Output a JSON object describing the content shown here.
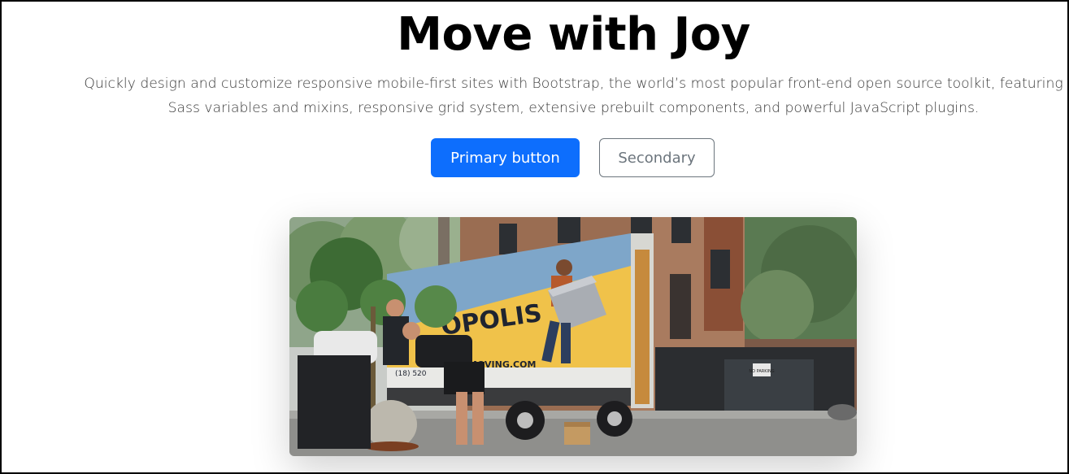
{
  "hero": {
    "title": "Move with Joy",
    "lead": "Quickly design and customize responsive mobile-first sites with Bootstrap, the world’s most popular front-end open source toolkit, featuring Sass variables and mixins, responsive grid system, extensive prebuilt components, and powerful JavaScript plugins.",
    "primary_button": "Primary button",
    "secondary_button": "Secondary"
  },
  "image": {
    "truck_text": "OPOLIS",
    "truck_subtext": "G",
    "truck_url": "MOVING.COM",
    "truck_phone": "(18) 520",
    "sign_text": "NO PARKING"
  },
  "colors": {
    "primary": "#0d6efd",
    "secondary": "#6c757d",
    "truck_blue": "#7ea6c9",
    "truck_yellow": "#f0c24a"
  }
}
